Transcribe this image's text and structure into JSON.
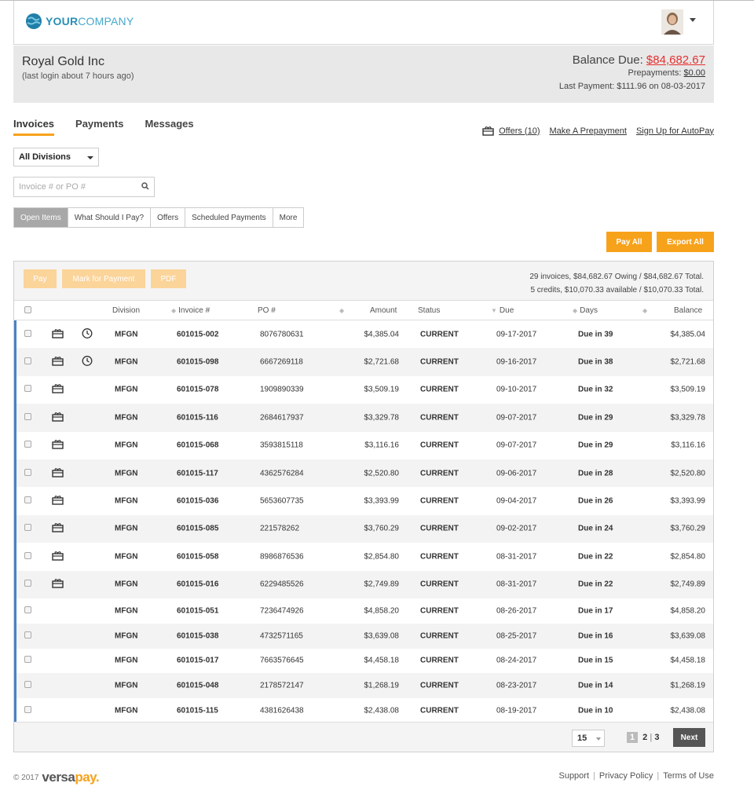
{
  "brand": {
    "logo_bold": "YOUR",
    "logo_thin": "COMPANY"
  },
  "account": {
    "name": "Royal Gold Inc",
    "last_login": "(last login about 7 hours ago)",
    "balance_label": "Balance Due: ",
    "balance_value": "$84,682.67",
    "prepay_label": "Prepayments: ",
    "prepay_value": "$0.00",
    "last_payment": "Last Payment: $111.96 on 08-03-2017"
  },
  "tabs": [
    "Invoices",
    "Payments",
    "Messages"
  ],
  "links": {
    "offers": "Offers (10)",
    "prepay": "Make A Prepayment",
    "autopay": "Sign Up for AutoPay"
  },
  "filters": {
    "division": "All Divisions",
    "search_placeholder": "Invoice # or PO #"
  },
  "segments": [
    "Open Items",
    "What Should I Pay?",
    "Offers",
    "Scheduled Payments",
    "More"
  ],
  "actions": {
    "pay_all": "Pay All",
    "export_all": "Export All"
  },
  "toolbar": {
    "pay": "Pay",
    "mark": "Mark for Payment",
    "pdf": "PDF"
  },
  "summary": {
    "line1": "29 invoices, $84,682.67 Owing / $84,682.67 Total.",
    "line2": "5 credits, $10,070.33 available / $10,070.33 Total."
  },
  "columns": {
    "division": "Division",
    "invoice": "Invoice #",
    "po": "PO #",
    "amount": "Amount",
    "status": "Status",
    "due": "Due",
    "days": "Days",
    "balance": "Balance"
  },
  "rows": [
    {
      "gift": true,
      "clock": true,
      "division": "MFGN",
      "invoice": "601015-002",
      "po": "8076780631",
      "amount": "$4,385.04",
      "status": "CURRENT",
      "due": "09-17-2017",
      "days": "Due in 39",
      "balance": "$4,385.04"
    },
    {
      "gift": true,
      "clock": true,
      "division": "MFGN",
      "invoice": "601015-098",
      "po": "6667269118",
      "amount": "$2,721.68",
      "status": "CURRENT",
      "due": "09-16-2017",
      "days": "Due in 38",
      "balance": "$2,721.68"
    },
    {
      "gift": true,
      "clock": false,
      "division": "MFGN",
      "invoice": "601015-078",
      "po": "1909890339",
      "amount": "$3,509.19",
      "status": "CURRENT",
      "due": "09-10-2017",
      "days": "Due in 32",
      "balance": "$3,509.19"
    },
    {
      "gift": true,
      "clock": false,
      "division": "MFGN",
      "invoice": "601015-116",
      "po": "2684617937",
      "amount": "$3,329.78",
      "status": "CURRENT",
      "due": "09-07-2017",
      "days": "Due in 29",
      "balance": "$3,329.78"
    },
    {
      "gift": true,
      "clock": false,
      "division": "MFGN",
      "invoice": "601015-068",
      "po": "3593815118",
      "amount": "$3,116.16",
      "status": "CURRENT",
      "due": "09-07-2017",
      "days": "Due in 29",
      "balance": "$3,116.16"
    },
    {
      "gift": true,
      "clock": false,
      "division": "MFGN",
      "invoice": "601015-117",
      "po": "4362576284",
      "amount": "$2,520.80",
      "status": "CURRENT",
      "due": "09-06-2017",
      "days": "Due in 28",
      "balance": "$2,520.80"
    },
    {
      "gift": true,
      "clock": false,
      "division": "MFGN",
      "invoice": "601015-036",
      "po": "5653607735",
      "amount": "$3,393.99",
      "status": "CURRENT",
      "due": "09-04-2017",
      "days": "Due in 26",
      "balance": "$3,393.99"
    },
    {
      "gift": true,
      "clock": false,
      "division": "MFGN",
      "invoice": "601015-085",
      "po": "221578262",
      "amount": "$3,760.29",
      "status": "CURRENT",
      "due": "09-02-2017",
      "days": "Due in 24",
      "balance": "$3,760.29"
    },
    {
      "gift": true,
      "clock": false,
      "division": "MFGN",
      "invoice": "601015-058",
      "po": "8986876536",
      "amount": "$2,854.80",
      "status": "CURRENT",
      "due": "08-31-2017",
      "days": "Due in 22",
      "balance": "$2,854.80"
    },
    {
      "gift": true,
      "clock": false,
      "division": "MFGN",
      "invoice": "601015-016",
      "po": "6229485526",
      "amount": "$2,749.89",
      "status": "CURRENT",
      "due": "08-31-2017",
      "days": "Due in 22",
      "balance": "$2,749.89"
    },
    {
      "gift": false,
      "clock": false,
      "division": "MFGN",
      "invoice": "601015-051",
      "po": "7236474926",
      "amount": "$4,858.20",
      "status": "CURRENT",
      "due": "08-26-2017",
      "days": "Due in 17",
      "balance": "$4,858.20"
    },
    {
      "gift": false,
      "clock": false,
      "division": "MFGN",
      "invoice": "601015-038",
      "po": "4732571165",
      "amount": "$3,639.08",
      "status": "CURRENT",
      "due": "08-25-2017",
      "days": "Due in 16",
      "balance": "$3,639.08"
    },
    {
      "gift": false,
      "clock": false,
      "division": "MFGN",
      "invoice": "601015-017",
      "po": "7663576645",
      "amount": "$4,458.18",
      "status": "CURRENT",
      "due": "08-24-2017",
      "days": "Due in 15",
      "balance": "$4,458.18"
    },
    {
      "gift": false,
      "clock": false,
      "division": "MFGN",
      "invoice": "601015-048",
      "po": "2178572147",
      "amount": "$1,268.19",
      "status": "CURRENT",
      "due": "08-23-2017",
      "days": "Due in 14",
      "balance": "$1,268.19"
    },
    {
      "gift": false,
      "clock": false,
      "division": "MFGN",
      "invoice": "601015-115",
      "po": "4381626438",
      "amount": "$2,438.08",
      "status": "CURRENT",
      "due": "08-19-2017",
      "days": "Due in 10",
      "balance": "$2,438.08"
    }
  ],
  "pagination": {
    "per_page": "15",
    "pages": [
      "1",
      "2",
      "3"
    ],
    "current": "1",
    "next": "Next"
  },
  "footer": {
    "copyright": "© 2017",
    "brand_a": "versa",
    "brand_b": "pay",
    "brand_dot": ".",
    "links": [
      "Support",
      "Privacy Policy",
      "Terms of Use"
    ]
  },
  "colors": {
    "accent": "#f7a21b",
    "row_marker": "#4a82c5",
    "balance_due": "#e63030"
  }
}
